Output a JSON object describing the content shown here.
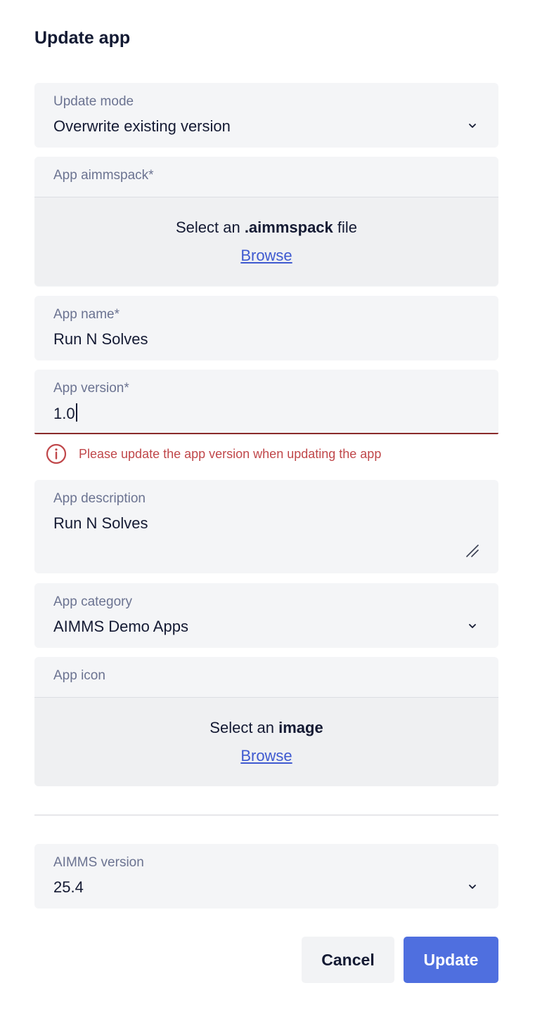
{
  "dialog": {
    "title": "Update app"
  },
  "update_mode": {
    "label": "Update mode",
    "value": "Overwrite existing version"
  },
  "aimmspack": {
    "label": "App aimmspack*",
    "prompt_prefix": "Select an ",
    "prompt_bold": ".aimmspack",
    "prompt_suffix": " file",
    "browse_label": "Browse"
  },
  "app_name": {
    "label": "App name*",
    "value": "Run N Solves"
  },
  "app_version": {
    "label": "App version*",
    "value": "1.0",
    "error": "Please update the app version when updating the app"
  },
  "app_description": {
    "label": "App description",
    "value": "Run N Solves"
  },
  "app_category": {
    "label": "App category",
    "value": "AIMMS Demo Apps"
  },
  "app_icon": {
    "label": "App icon",
    "prompt_prefix": "Select an ",
    "prompt_bold": "image",
    "browse_label": "Browse"
  },
  "aimms_version": {
    "label": "AIMMS version",
    "value": "25.4"
  },
  "actions": {
    "cancel_label": "Cancel",
    "update_label": "Update"
  },
  "colors": {
    "accent": "#4f6fdf",
    "link": "#3f5ad0",
    "error": "#c0474a",
    "field_bg": "#f4f5f7"
  }
}
